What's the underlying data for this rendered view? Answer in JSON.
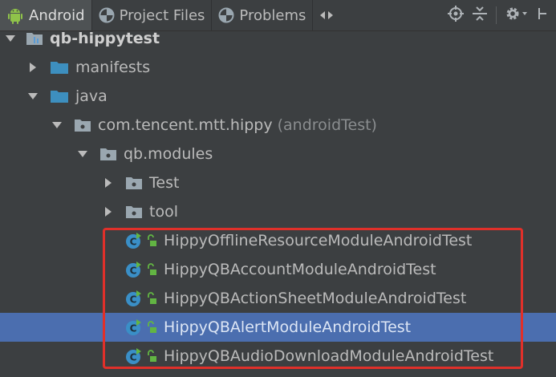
{
  "tabs": [
    {
      "label": "Android",
      "icon": "android-icon",
      "active": true
    },
    {
      "label": "Project Files",
      "icon": "project-files-icon",
      "active": false
    },
    {
      "label": "Problems",
      "icon": "problems-icon",
      "active": false
    }
  ],
  "toolbar": {
    "icons": [
      "target-icon",
      "collapse-all-icon",
      "gear-icon",
      "hide-panel-icon"
    ]
  },
  "tree": {
    "root": {
      "label": "qb-hippytest"
    },
    "manifests": {
      "label": "manifests"
    },
    "java": {
      "label": "java"
    },
    "package": {
      "label": "com.tencent.mtt.hippy",
      "suffix": "(androidTest)"
    },
    "modules": {
      "label": "qb.modules"
    },
    "test_folder": {
      "label": "Test"
    },
    "tool_folder": {
      "label": "tool"
    },
    "classes": [
      {
        "label": "HippyOfflineResourceModuleAndroidTest"
      },
      {
        "label": "HippyQBAccountModuleAndroidTest"
      },
      {
        "label": "HippyQBActionSheetModuleAndroidTest"
      },
      {
        "label": "HippyQBAlertModuleAndroidTest",
        "selected": true
      },
      {
        "label": "HippyQBAudioDownloadModuleAndroidTest"
      }
    ]
  },
  "colors": {
    "background": "#3c3f41",
    "selection": "#4b6eaf",
    "highlight_border": "#e0302a",
    "folder_blue": "#3d8fbf",
    "class_icon": "#3a8fc7"
  }
}
